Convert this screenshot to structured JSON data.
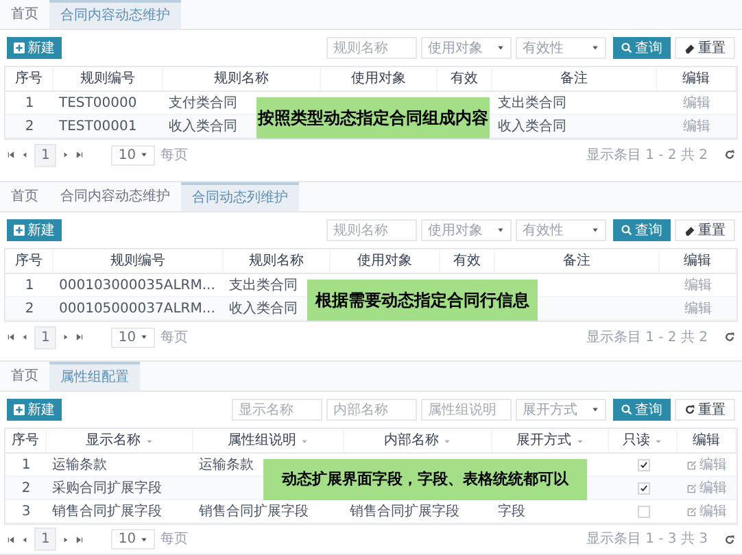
{
  "panels": [
    {
      "tabs": [
        {
          "label": "首页",
          "selected": false
        },
        {
          "label": "合同内容动态维护",
          "selected": true
        }
      ],
      "new_button": "新建",
      "filters": [
        {
          "kind": "input",
          "placeholder": "规则名称"
        },
        {
          "kind": "select",
          "placeholder": "使用对象"
        },
        {
          "kind": "select",
          "placeholder": "有效性"
        }
      ],
      "search_button": "查询",
      "reset_button": {
        "label": "重置",
        "kind": "eraser"
      },
      "columns": [
        {
          "label": "序号"
        },
        {
          "label": "规则编号"
        },
        {
          "label": "规则名称"
        },
        {
          "label": "使用对象"
        },
        {
          "label": "有效"
        },
        {
          "label": "备注"
        },
        {
          "label": "编辑"
        }
      ],
      "rows": [
        {
          "cells": [
            "1",
            "TEST00000",
            "支付类合同",
            null,
            null,
            "支出类合同",
            "编辑"
          ]
        },
        {
          "cells": [
            "2",
            "TEST00001",
            "收入类合同",
            null,
            null,
            "收入类合同",
            "编辑"
          ]
        }
      ],
      "pager": {
        "page": "1",
        "per_page": "10",
        "per_page_label": "每页",
        "summary": "显示条目 1 - 2 共 2"
      },
      "note": "按照类型动态指定合同组成内容"
    },
    {
      "tabs": [
        {
          "label": "首页",
          "selected": false
        },
        {
          "label": "合同内容动态维护",
          "selected": false
        },
        {
          "label": "合同动态列维护",
          "selected": true
        }
      ],
      "new_button": "新建",
      "filters": [
        {
          "kind": "input",
          "placeholder": "规则名称"
        },
        {
          "kind": "select",
          "placeholder": "使用对象"
        },
        {
          "kind": "select",
          "placeholder": "有效性"
        }
      ],
      "search_button": "查询",
      "reset_button": {
        "label": "重置",
        "kind": "eraser"
      },
      "columns": [
        {
          "label": "序号"
        },
        {
          "label": "规则编号"
        },
        {
          "label": "规则名称"
        },
        {
          "label": "使用对象"
        },
        {
          "label": "有效"
        },
        {
          "label": "备注"
        },
        {
          "label": "编辑"
        }
      ],
      "rows": [
        {
          "cells": [
            "1",
            "000103000035ALRM...",
            "支出类合同",
            null,
            null,
            null,
            "编辑"
          ]
        },
        {
          "cells": [
            "2",
            "000105000037ALRM...",
            "收入类合同",
            null,
            null,
            null,
            "编辑"
          ]
        }
      ],
      "pager": {
        "page": "1",
        "per_page": "10",
        "per_page_label": "每页",
        "summary": "显示条目 1 - 2 共 2"
      },
      "note": "根据需要动态指定合同行信息"
    },
    {
      "tabs": [
        {
          "label": "首页",
          "selected": false
        },
        {
          "label": "属性组配置",
          "selected": true
        }
      ],
      "new_button": "新建",
      "filters": [
        {
          "kind": "input",
          "placeholder": "显示名称"
        },
        {
          "kind": "input",
          "placeholder": "内部名称"
        },
        {
          "kind": "input",
          "placeholder": "属性组说明"
        },
        {
          "kind": "select",
          "placeholder": "展开方式"
        }
      ],
      "search_button": "查询",
      "reset_button": {
        "label": "重置",
        "kind": "refresh"
      },
      "columns": [
        {
          "label": "序号",
          "sortable": false
        },
        {
          "label": "显示名称",
          "sortable": true
        },
        {
          "label": "属性组说明",
          "sortable": true
        },
        {
          "label": "内部名称",
          "sortable": true
        },
        {
          "label": "展开方式",
          "sortable": true
        },
        {
          "label": "只读",
          "sortable": true
        },
        {
          "label": "编辑",
          "sortable": false
        }
      ],
      "rows": [
        {
          "cells": [
            "1",
            "运输条款",
            "运输条款",
            null,
            null,
            {
              "checked": true
            },
            "编辑"
          ]
        },
        {
          "cells": [
            "2",
            "采购合同扩展字段",
            null,
            null,
            null,
            {
              "checked": true
            },
            "编辑"
          ]
        },
        {
          "cells": [
            "3",
            "销售合同扩展字段",
            "销售合同扩展字段",
            "销售合同扩展字段",
            "字段",
            {
              "checked": false
            },
            "编辑"
          ]
        }
      ],
      "pager": {
        "page": "1",
        "per_page": "10",
        "per_page_label": "每页",
        "summary": "显示条目 1 - 3 共 3"
      },
      "note": "动态扩展界面字段，字段、表格统统都可以"
    }
  ]
}
